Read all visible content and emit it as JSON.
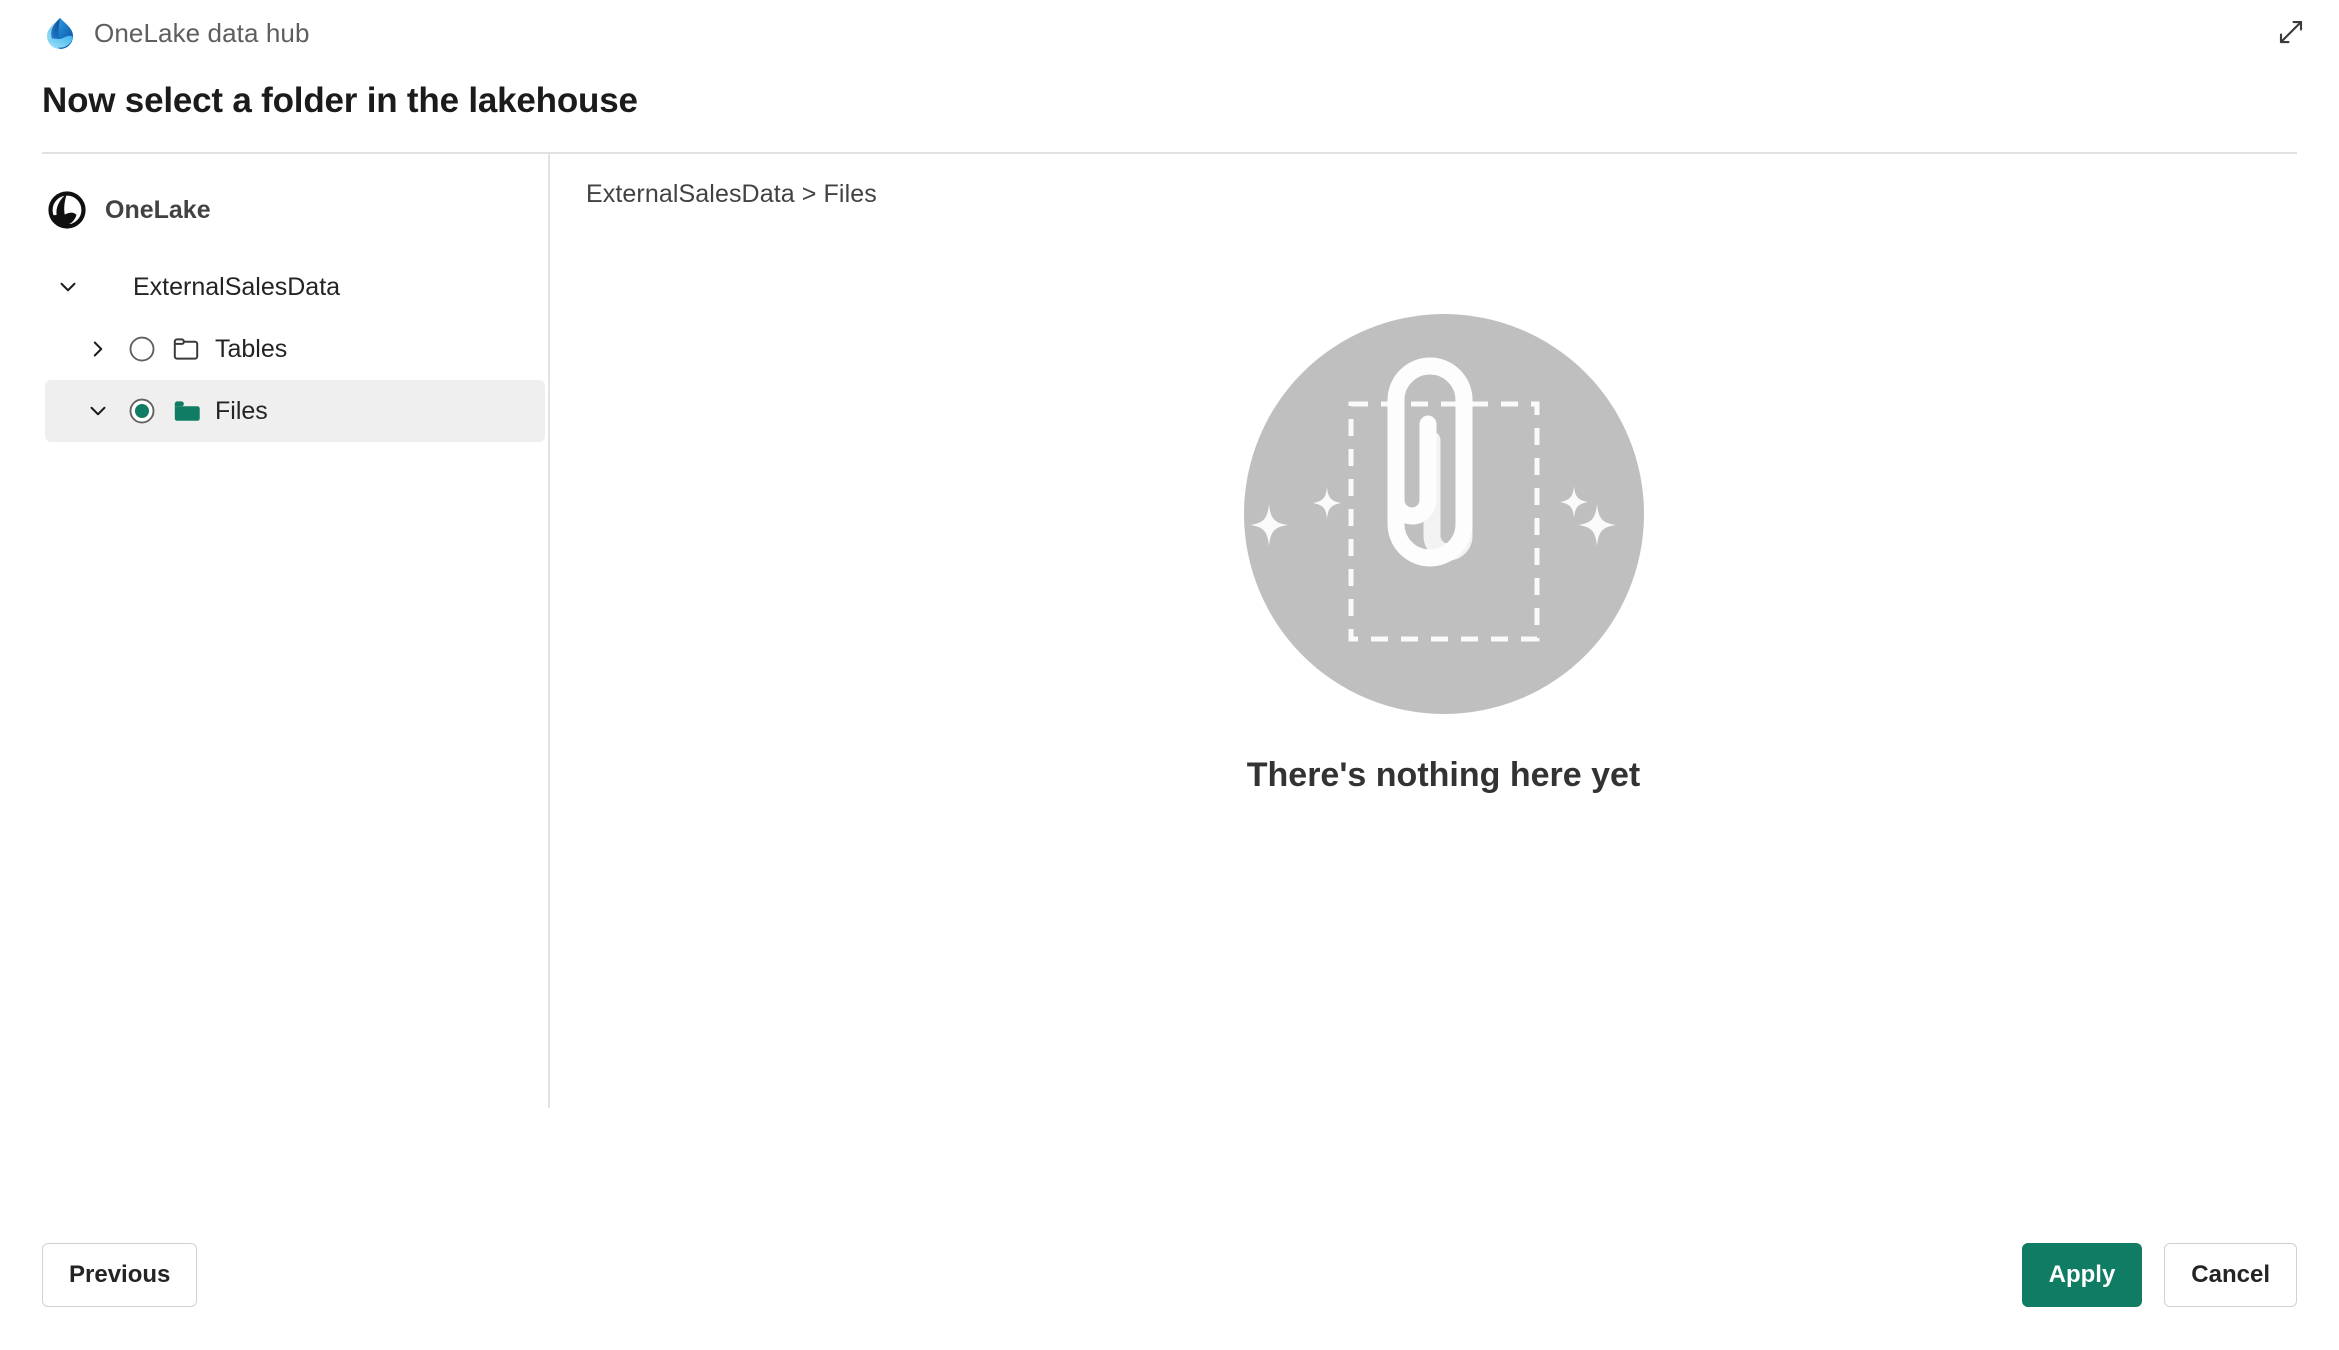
{
  "header": {
    "logo_icon": "onelake-droplet-logo",
    "title": "OneLake data hub",
    "expand_icon": "expand-diagonal-icon"
  },
  "page": {
    "title": "Now select a folder in the lakehouse"
  },
  "sidebar": {
    "root": {
      "icon": "onelake-circle-icon",
      "label": "OneLake"
    },
    "tree": [
      {
        "label": "ExternalSalesData",
        "level": 0,
        "chevron": "chevron-down-icon",
        "expanded": true,
        "has_radio": false,
        "has_folder_icon": false,
        "selected": false
      },
      {
        "label": "Tables",
        "level": 1,
        "chevron": "chevron-right-icon",
        "expanded": false,
        "has_radio": true,
        "radio_checked": false,
        "folder_icon": "folder-outline-icon",
        "selected": false
      },
      {
        "label": "Files",
        "level": 1,
        "chevron": "chevron-down-icon",
        "expanded": true,
        "has_radio": true,
        "radio_checked": true,
        "folder_icon": "folder-filled-icon",
        "selected": true
      }
    ]
  },
  "content": {
    "breadcrumb": {
      "items": [
        "ExternalSalesData",
        "Files"
      ],
      "separator": ">",
      "text": "ExternalSalesData > Files"
    },
    "empty_state": {
      "illustration_icon": "paperclip-empty-folder-illustration",
      "message": "There's nothing here yet"
    }
  },
  "footer": {
    "previous_label": "Previous",
    "apply_label": "Apply",
    "cancel_label": "Cancel"
  },
  "colors": {
    "accent_teal": "#107c64",
    "selected_row_bg": "#efefef",
    "divider": "#e1e1e1",
    "illustration_circle": "#bfbfbf",
    "title_text": "#1b1b1b",
    "muted_text": "#5e5e5e"
  }
}
